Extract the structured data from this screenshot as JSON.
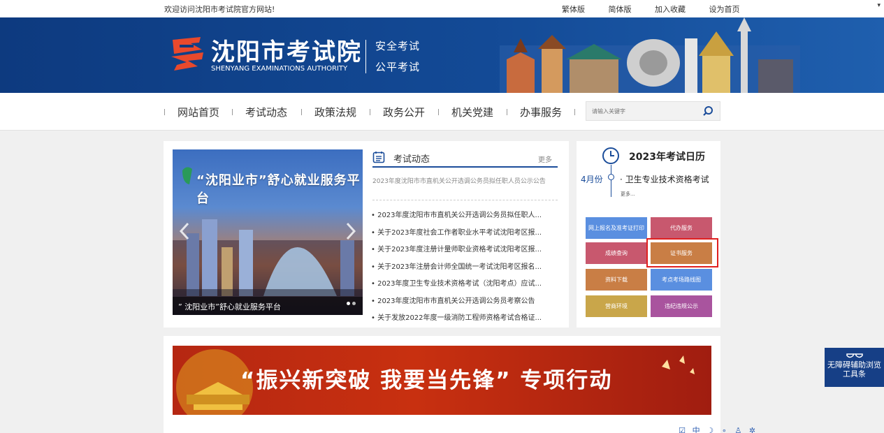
{
  "topbar": {
    "welcome": "欢迎访问沈阳市考试院官方网站!",
    "links": [
      "繁体版",
      "简体版",
      "加入收藏",
      "设为首页"
    ]
  },
  "header": {
    "title": "沈阳市考试院",
    "subtitle": "SHENYANG EXAMINATIONS AUTHORITY",
    "slogan1": "安全考试",
    "slogan2": "公平考试"
  },
  "nav": {
    "items": [
      "网站首页",
      "考试动态",
      "政策法规",
      "政务公开",
      "机关党建",
      "办事服务"
    ],
    "search_placeholder": "请输入关键字"
  },
  "slider": {
    "banner_title": "“沈阳业市”舒心就业服务平台",
    "caption": "” 沈阳业市”舒心就业服务平台"
  },
  "news": {
    "title": "考试动态",
    "more": "更多",
    "top": "2023年度沈阳市市直机关公开选调公务员拟任职人员公示公告",
    "items": [
      "• 2023年度沈阳市市直机关公开选调公务员拟任职人...",
      "• 关于2023年度社会工作者职业水平考试沈阳考区报...",
      "• 关于2023年度注册计量师职业资格考试沈阳考区报...",
      "• 关于2023年注册会计师全国统一考试沈阳考区报名...",
      "• 2023年度卫生专业技术资格考试（沈阳考点）应试...",
      "• 2023年度沈阳市市直机关公开选调公务员考察公告",
      "• 关于发放2022年度一级消防工程师资格考试合格证..."
    ]
  },
  "calendar": {
    "title": "2023年考试日历",
    "month": "4月份",
    "event": "· 卫生专业技术资格考试",
    "more": "更多..."
  },
  "services": [
    {
      "label": "网上报名及准考证打印",
      "color": "#5a8fe0"
    },
    {
      "label": "代办服务",
      "color": "#c8586e"
    },
    {
      "label": "成绩查询",
      "color": "#c8586e"
    },
    {
      "label": "证书服务",
      "color": "#c97e45"
    },
    {
      "label": "资料下载",
      "color": "#c97e45"
    },
    {
      "label": "考点考场路线图",
      "color": "#5a8fe0"
    },
    {
      "label": "营商环境",
      "color": "#c9a64a"
    },
    {
      "label": "违纪违规公示",
      "color": "#a9549e"
    }
  ],
  "promo": {
    "text": "“振兴新突破 我要当先锋” 专项行动"
  },
  "accessibility": {
    "line1": "无障碍辅助浏览",
    "line2": "工具条"
  },
  "tools": [
    "☑",
    "中",
    "☽",
    "∘",
    "♙",
    "✲"
  ]
}
